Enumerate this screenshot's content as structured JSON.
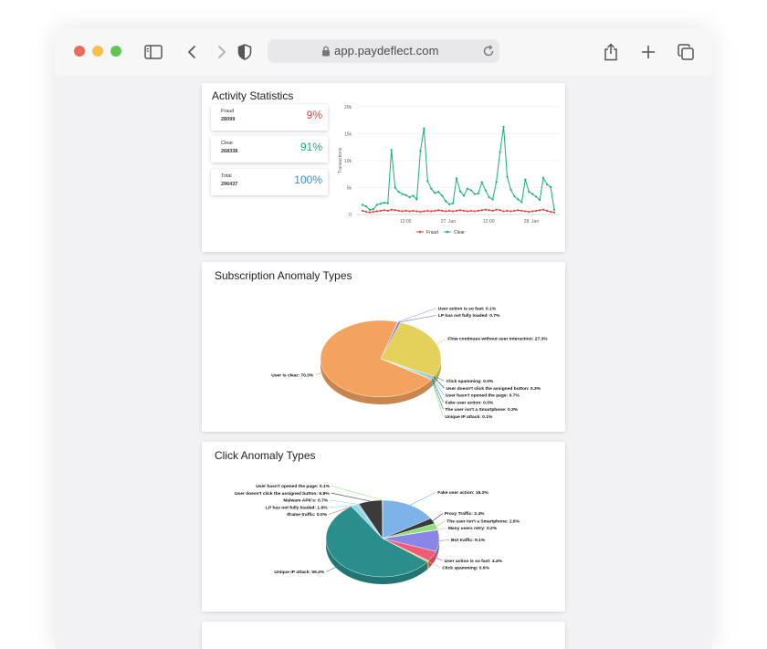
{
  "browser": {
    "url": "app.paydeflect.com",
    "traffic_lights": [
      "#ed6a5e",
      "#f5bf4f",
      "#61c554"
    ]
  },
  "activity": {
    "title": "Activity Statistics",
    "stats": [
      {
        "label": "Fraud",
        "count": "28099",
        "percent": "9%",
        "color": "#e8413f"
      },
      {
        "label": "Clear",
        "count": "268338",
        "percent": "91%",
        "color": "#1aad77"
      },
      {
        "label": "Total",
        "count": "296437",
        "percent": "100%",
        "color": "#2f8fd8"
      }
    ],
    "chart_data": {
      "type": "line",
      "ylabel": "Transactions",
      "yticks": [
        "0",
        "5k",
        "10k",
        "15k",
        "20k"
      ],
      "ylim": [
        0,
        20000
      ],
      "xticks": [
        "12:00",
        "27. Jan",
        "12:00",
        "28. Jan"
      ],
      "legend": [
        "Fraud",
        "Clear"
      ],
      "legend_position": "bottom",
      "series": [
        {
          "name": "Fraud",
          "color": "#e8413f",
          "values": [
            700,
            500,
            400,
            500,
            600,
            700,
            800,
            700,
            900,
            800,
            700,
            600,
            700,
            600,
            700,
            600,
            500,
            600,
            700,
            600,
            700,
            800,
            700,
            600,
            700,
            600,
            700,
            800,
            700,
            600,
            700,
            600,
            700,
            800,
            900,
            800,
            700,
            900,
            800,
            600,
            700,
            600,
            700,
            800,
            700,
            600,
            500,
            600,
            700,
            800,
            900,
            700,
            500,
            400
          ]
        },
        {
          "name": "Clear",
          "color": "#1aad77",
          "values": [
            1800,
            1500,
            900,
            1000,
            1800,
            2000,
            2200,
            2100,
            12000,
            5000,
            4200,
            3800,
            3600,
            3200,
            3500,
            2800,
            11800,
            16000,
            6200,
            4800,
            4000,
            4200,
            3500,
            2500,
            1900,
            2100,
            6700,
            4300,
            3500,
            4800,
            4500,
            3800,
            3900,
            6000,
            4500,
            3200,
            2800,
            6000,
            11600,
            16300,
            7000,
            4600,
            3400,
            2800,
            2300,
            6500,
            4200,
            3800,
            3300,
            2700,
            6800,
            5600,
            5100,
            900
          ]
        }
      ]
    }
  },
  "subscription": {
    "title": "Subscription Anomaly Types",
    "chart_data": {
      "type": "pie",
      "slices": [
        {
          "label": "User is clear: 70.3%",
          "value": 70.3,
          "color": "#f4a35f"
        },
        {
          "label": "User action is so fast: 0.1%",
          "value": 0.1,
          "color": "#7aa6e0"
        },
        {
          "label": "LP has not fully loaded: 0.7%",
          "value": 0.7,
          "color": "#8e7fd6"
        },
        {
          "label": "Flow continues without user interaction: 27.3%",
          "value": 27.3,
          "color": "#e3d15b"
        },
        {
          "label": "Click spamming: 0.0%",
          "value": 0.05,
          "color": "#4a9e9e"
        },
        {
          "label": "User doesn't click the assigned button: 0.3%",
          "value": 0.3,
          "color": "#444444"
        },
        {
          "label": "User hasn't opened the page: 0.7%",
          "value": 0.7,
          "color": "#6bc7d6"
        },
        {
          "label": "Fake user action: 0.0%",
          "value": 0.05,
          "color": "#3d7db8"
        },
        {
          "label": "The user isn't a Smartphone: 0.3%",
          "value": 0.3,
          "color": "#2b7e7a"
        },
        {
          "label": "Unique IP attack: 0.1%",
          "value": 0.1,
          "color": "#90e070"
        }
      ]
    }
  },
  "click": {
    "title": "Click Anomaly Types",
    "chart_data": {
      "type": "pie",
      "slices": [
        {
          "label": "Fake user action: 16.2%",
          "value": 16.2,
          "color": "#7cb4ea"
        },
        {
          "label": "Proxy Traffic: 2.4%",
          "value": 2.4,
          "color": "#3a3a3a"
        },
        {
          "label": "The user isn't a Smartphone: 2.6%",
          "value": 2.6,
          "color": "#8fe07a"
        },
        {
          "label": "Many users retry: 0.2%",
          "value": 0.2,
          "color": "#f4a35f"
        },
        {
          "label": "Bot traffic: 9.1%",
          "value": 9.1,
          "color": "#8a86e6"
        },
        {
          "label": "User action is so fast: 4.4%",
          "value": 4.4,
          "color": "#ef5c78"
        },
        {
          "label": "Click spamming: 0.6%",
          "value": 0.6,
          "color": "#e2d65a"
        },
        {
          "label": "Unique IP attack: 55.4%",
          "value": 55.4,
          "color": "#2a8f8c"
        },
        {
          "label": "Iframe traffic: 0.0%",
          "value": 0.05,
          "color": "#e3675c"
        },
        {
          "label": "LP has not fully loaded: 1.6%",
          "value": 1.6,
          "color": "#8ad7ea"
        },
        {
          "label": "Malware APK's: 0.7%",
          "value": 0.7,
          "color": "#9bd2e8"
        },
        {
          "label": "User doesn't click the assigned button: 6.8%",
          "value": 6.8,
          "color": "#3b3b3b"
        },
        {
          "label": "User hasn't opened the page: 0.1%",
          "value": 0.1,
          "color": "#a3e27d"
        }
      ]
    }
  }
}
